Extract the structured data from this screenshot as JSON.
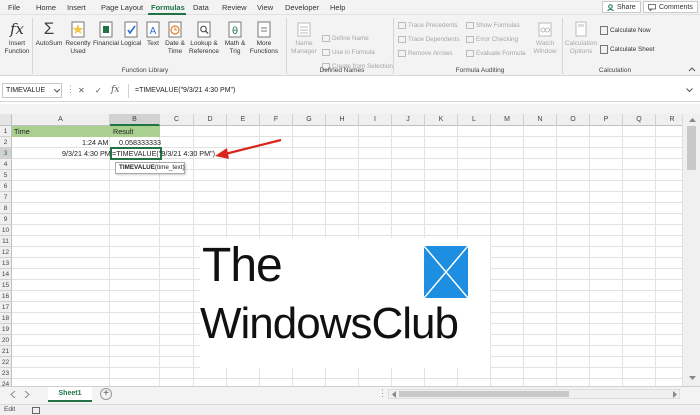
{
  "menu": {
    "tabs": [
      "File",
      "Home",
      "Insert",
      "Page Layout",
      "Formulas",
      "Data",
      "Review",
      "View",
      "Developer",
      "Help"
    ],
    "active": "Formulas",
    "share": "Share",
    "comments": "Comments"
  },
  "ribbon": {
    "insert_function": [
      "Insert",
      "Function"
    ],
    "autosum": "AutoSum",
    "recently_used": [
      "Recently",
      "Used"
    ],
    "financial": "Financial",
    "logical": "Logical",
    "text": "Text",
    "date_time": [
      "Date &",
      "Time"
    ],
    "lookup": [
      "Lookup &",
      "Reference"
    ],
    "math": [
      "Math &",
      "Trig"
    ],
    "more": [
      "More",
      "Functions"
    ],
    "function_library": "Function Library",
    "name_manager": [
      "Name",
      "Manager"
    ],
    "define_name": "Define Name",
    "use_in_formula": "Use in Formula",
    "create_from_selection": "Create from Selection",
    "defined_names": "Defined Names",
    "trace_precedents": "Trace Precedents",
    "trace_dependents": "Trace Dependents",
    "remove_arrows": "Remove Arrows",
    "show_formulas": "Show Formulas",
    "error_checking": "Error Checking",
    "evaluate_formula": "Evaluate Formula",
    "watch_window": [
      "Watch",
      "Window"
    ],
    "formula_auditing": "Formula Auditing",
    "calc_options": [
      "Calculation",
      "Options"
    ],
    "calc_now": "Calculate Now",
    "calc_sheet": "Calculate Sheet",
    "calculation": "Calculation"
  },
  "formula_bar": {
    "name_box": "TIMEVALUE",
    "cancel": "✕",
    "enter": "✓",
    "fx": "fx",
    "formula": "=TIMEVALUE(\"9/3/21 4:30 PM\")"
  },
  "columns": [
    "A",
    "B",
    "C",
    "D",
    "E",
    "F",
    "G",
    "H",
    "I",
    "J",
    "K",
    "L",
    "M",
    "N",
    "O",
    "P",
    "Q",
    "R"
  ],
  "rows": [
    "1",
    "2",
    "3",
    "4",
    "5",
    "6",
    "7",
    "8",
    "9",
    "10",
    "11",
    "12",
    "13",
    "14",
    "15",
    "16",
    "17",
    "18",
    "19",
    "20",
    "21",
    "22",
    "23",
    "24"
  ],
  "cells": {
    "a1": "Time",
    "b1": "Result",
    "a2": "1:24 AM",
    "b2": "0.058333333",
    "a3": "9/3/21 4:30 PM",
    "b3": "=TIMEVALUE(\"9/3/21 4:30 PM\")",
    "tooltip_fn": "TIMEVALUE",
    "tooltip_arg": "(time_text)"
  },
  "watermark": {
    "line1": "The",
    "line2": "WindowsClub"
  },
  "sheet": {
    "tab": "Sheet1",
    "add": "+"
  },
  "status": {
    "mode": "Edit"
  },
  "colors": {
    "accent": "#217346",
    "header_fill": "#a9d08e",
    "arrow": "#d9261c",
    "logo_blue": "#1e8ee0"
  }
}
